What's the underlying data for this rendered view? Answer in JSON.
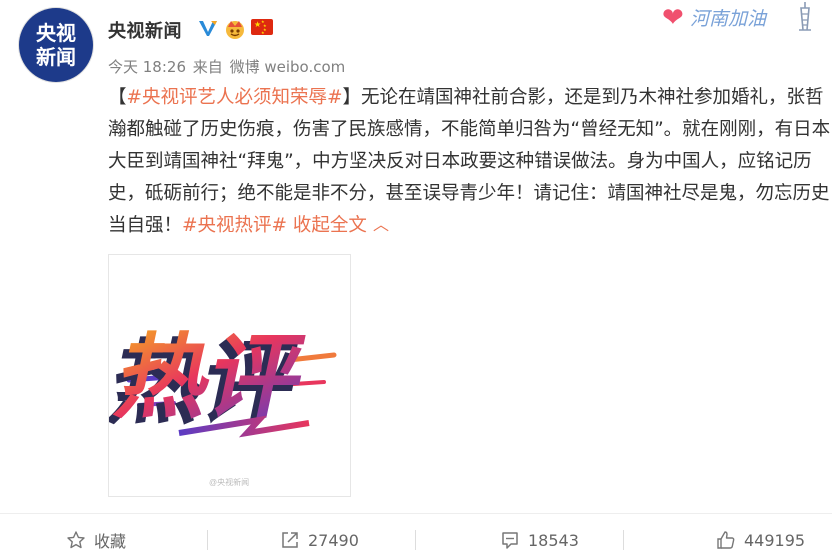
{
  "account": {
    "name": "央视新闻",
    "avatar_text": [
      "央视",
      "新闻"
    ]
  },
  "meta": {
    "time": "今天 18:26",
    "source_prefix": "来自",
    "source": "微博 weibo.com"
  },
  "badge": {
    "text": "河南加油"
  },
  "post": {
    "open_bracket": "【",
    "topic_tag": "#央视评艺人必须知荣辱#",
    "close_bracket": "】",
    "body": "无论在靖国神社前合影，还是到乃木神社参加婚礼，张哲瀚都触碰了历史伤痕，伤害了民族感情，不能简单归咎为“曾经无知”。就在刚刚，有日本大臣到靖国神社“拜鬼”，中方坚决反对日本政要这种错误做法。身为中国人，应铭记历史，砥砺前行；绝不能是非不分，甚至误导青少年！请记住：靖国神社尽是鬼，勿忘历史当自强！",
    "end_tag": "#央视热评#",
    "collapse_label": "收起全文"
  },
  "image": {
    "graphic_text": "热评",
    "watermark": "@央视新闻"
  },
  "actions": {
    "favorite": "收藏",
    "repost": "27490",
    "comment": "18543",
    "like": "449195"
  },
  "colors": {
    "link": "#eb7350",
    "text": "#333333",
    "meta": "#808080"
  },
  "icons": {
    "verified": "verified-v-icon",
    "crown": "crown-icon",
    "flag": "china-flag-icon",
    "favorite": "star-icon",
    "repost": "share-arrow-icon",
    "comment": "comment-bubble-icon",
    "like": "thumbs-up-icon",
    "collapse": "chevron-up-icon"
  }
}
